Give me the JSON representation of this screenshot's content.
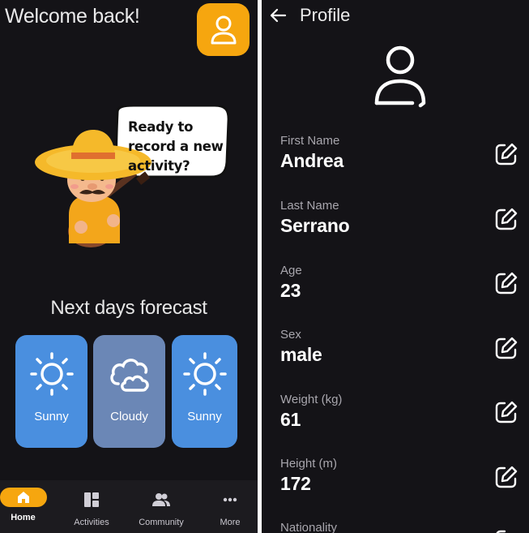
{
  "home": {
    "greeting": "Welcome back!",
    "speech_bubble": "Ready to record a new activity?",
    "forecast_title": "Next days forecast",
    "forecast": [
      {
        "label": "Sunny",
        "icon": "sun-icon",
        "color": "#4a8fdf"
      },
      {
        "label": "Cloudy",
        "icon": "cloud-icon",
        "color": "#6b87b6"
      },
      {
        "label": "Sunny",
        "icon": "sun-icon",
        "color": "#4a8fdf"
      }
    ],
    "nav": [
      {
        "label": "Home",
        "icon": "home-icon",
        "active": true
      },
      {
        "label": "Activities",
        "icon": "dashboard-icon",
        "active": false
      },
      {
        "label": "Community",
        "icon": "people-icon",
        "active": false
      },
      {
        "label": "More",
        "icon": "more-icon",
        "active": false
      }
    ],
    "accent_color": "#f6a60f"
  },
  "profile": {
    "title": "Profile",
    "fields": [
      {
        "label": "First Name",
        "value": "Andrea"
      },
      {
        "label": "Last Name",
        "value": "Serrano"
      },
      {
        "label": "Age",
        "value": "23"
      },
      {
        "label": "Sex",
        "value": "male"
      },
      {
        "label": "Weight (kg)",
        "value": "61"
      },
      {
        "label": "Height (m)",
        "value": "172"
      },
      {
        "label": "Nationality",
        "value": ""
      }
    ]
  }
}
